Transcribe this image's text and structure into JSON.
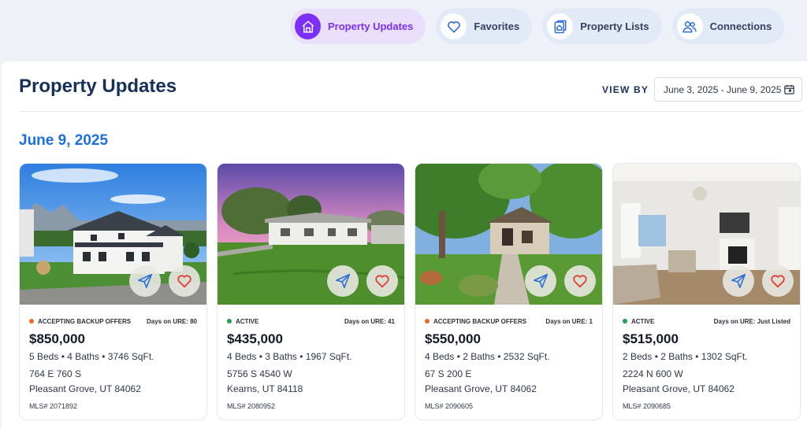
{
  "nav": {
    "items": [
      {
        "label": "Property Updates",
        "icon": "home-icon",
        "active": true
      },
      {
        "label": "Favorites",
        "icon": "heart-icon",
        "active": false
      },
      {
        "label": "Property Lists",
        "icon": "property-list-icon",
        "active": false
      },
      {
        "label": "Connections",
        "icon": "users-icon",
        "active": false
      }
    ]
  },
  "page": {
    "title": "Property Updates",
    "view_by_label": "VIEW BY",
    "date_range": "June 3, 2025 - June 9, 2025",
    "date_heading": "June 9, 2025"
  },
  "listings": [
    {
      "status": "ACCEPTING BACKUP OFFERS",
      "status_color": "#f26522",
      "days": "Days on URE: 80",
      "price": "$850,000",
      "specs": "5 Beds • 4 Baths • 3746 SqFt.",
      "address_line1": "764 E 760 S",
      "address_line2": "Pleasant Grove, UT 84062",
      "mls": "MLS# 2071892"
    },
    {
      "status": "ACTIVE",
      "status_color": "#22a04a",
      "days": "Days on URE: 41",
      "price": "$435,000",
      "specs": "4 Beds • 3 Baths • 1967 SqFt.",
      "address_line1": "5756 S 4540 W",
      "address_line2": "Kearns, UT 84118",
      "mls": "MLS# 2080952"
    },
    {
      "status": "ACCEPTING BACKUP OFFERS",
      "status_color": "#f26522",
      "days": "Days on URE: 1",
      "price": "$550,000",
      "specs": "4 Beds • 2 Baths • 2532 SqFt.",
      "address_line1": "67 S 200 E",
      "address_line2": "Pleasant Grove, UT 84062",
      "mls": "MLS# 2090605"
    },
    {
      "status": "ACTIVE",
      "status_color": "#22a04a",
      "days": "Days on URE: Just Listed",
      "price": "$515,000",
      "specs": "2 Beds • 2 Baths • 1302 SqFt.",
      "address_line1": "2224 N 600 W",
      "address_line2": "Pleasant Grove, UT 84062",
      "mls": "MLS# 2090685"
    }
  ],
  "colors": {
    "accent": "#7b2ff7",
    "heading_blue": "#1b6fe0",
    "title_navy": "#17305a",
    "favorite_red": "#e0413a",
    "share_blue": "#2f6fd6"
  }
}
